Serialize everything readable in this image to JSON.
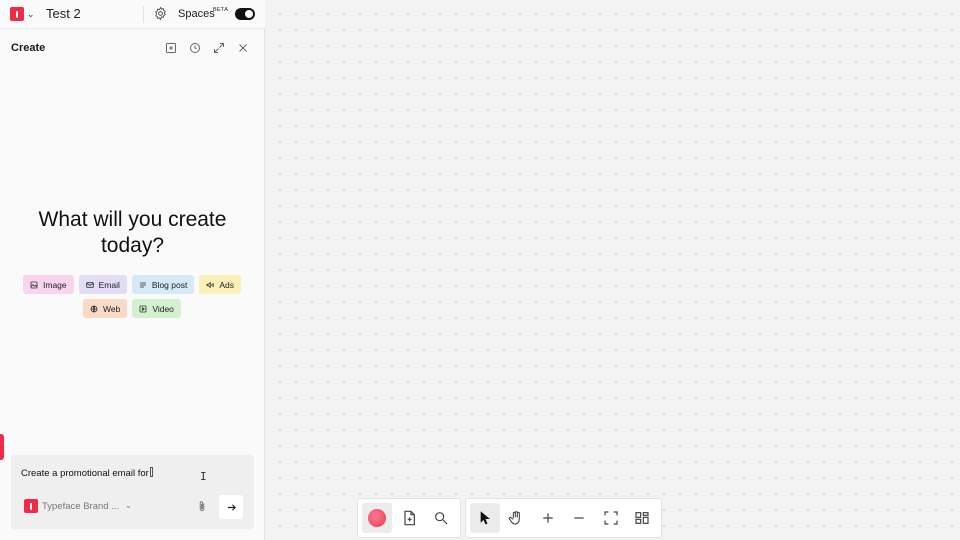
{
  "header": {
    "doc_title": "Test 2",
    "spaces_label": "Spaces",
    "beta_badge": "BETA"
  },
  "panel": {
    "title": "Create",
    "hero_line1": "What will you create",
    "hero_line2": "today?",
    "chips_row1": [
      {
        "label": "Image",
        "icon": "image-icon",
        "color": "#f9d4ef"
      },
      {
        "label": "Email",
        "icon": "mail-icon",
        "color": "#e3dcf7"
      },
      {
        "label": "Blog post",
        "icon": "text-lines-icon",
        "color": "#d6e9f7"
      },
      {
        "label": "Ads",
        "icon": "megaphone-icon",
        "color": "#faf0b8"
      }
    ],
    "chips_row2": [
      {
        "label": "Web",
        "icon": "globe-icon",
        "color": "#f9dac6"
      },
      {
        "label": "Video",
        "icon": "play-icon",
        "color": "#d4f1cf"
      }
    ]
  },
  "composer": {
    "value": "Create a promotional email for",
    "brand_kit": "Typeface Brand ..."
  },
  "colors": {
    "brand": "#ef2b47",
    "canvas_bg": "#f3f3f3"
  }
}
